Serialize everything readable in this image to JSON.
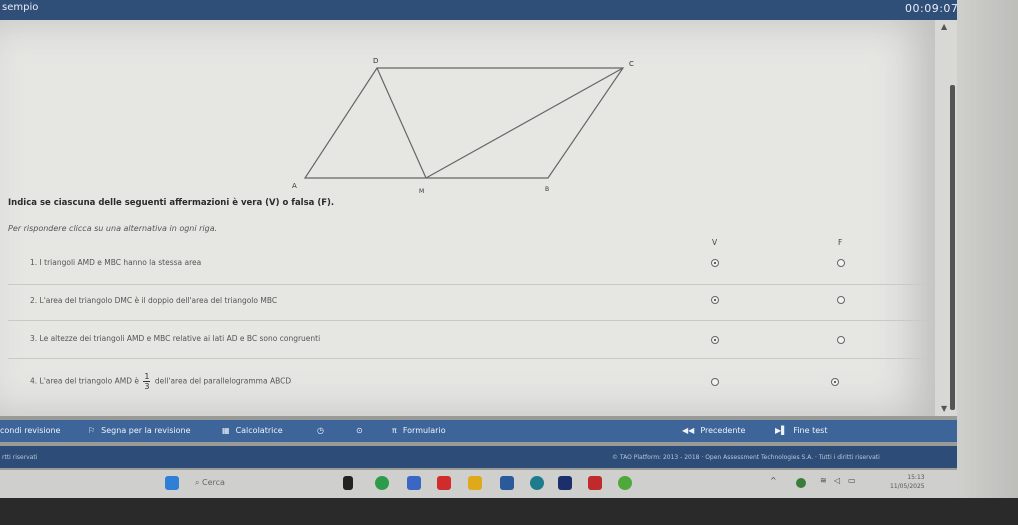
{
  "header": {
    "title": "sempio",
    "timer": "00:09:07"
  },
  "figure": {
    "labels": {
      "A": "A",
      "B": "B",
      "C": "C",
      "D": "D",
      "M": "M"
    }
  },
  "question": "Indica se ciascuna delle seguenti affermazioni è vera (V) o falsa (F).",
  "instruction": "Per rispondere clicca su una alternativa in ogni riga.",
  "columns": {
    "v": "V",
    "f": "F"
  },
  "rows": [
    {
      "text": "1. I triangoli AMD e MBC hanno la stessa area",
      "selected": "v"
    },
    {
      "text": "2. L'area del triangolo DMC è il doppio dell'area del triangolo MBC",
      "selected": "v"
    },
    {
      "text": "3. Le altezze dei triangoli AMD e MBC relative ai lati AD e BC sono congruenti",
      "selected": "v"
    },
    {
      "text_before": "4. L'area del triangolo AMD è",
      "frac_num": "1",
      "frac_den": "3",
      "text_after": "dell'area del parallelogramma ABCD",
      "selected": "f"
    }
  ],
  "toolbar": {
    "review": "condi revisione",
    "mark": "Segna per la revisione",
    "calculator": "Calcolatrice",
    "formulary": "Formulario",
    "prev": "Precedente",
    "end": "Fine test",
    "icons": [
      "flag-icon",
      "calculator-icon",
      "clock-icon",
      "target-icon",
      "pi-icon",
      "rewind-icon",
      "end-icon"
    ]
  },
  "footer": {
    "left": "rtti riservati",
    "right": "© TAO Platform: 2013 - 2018 · Open Assessment Technologies S.A. · Tutti i diritti riservati"
  },
  "taskbar": {
    "search": "Cerca",
    "time": "15:13",
    "date": "11/05/2025"
  }
}
